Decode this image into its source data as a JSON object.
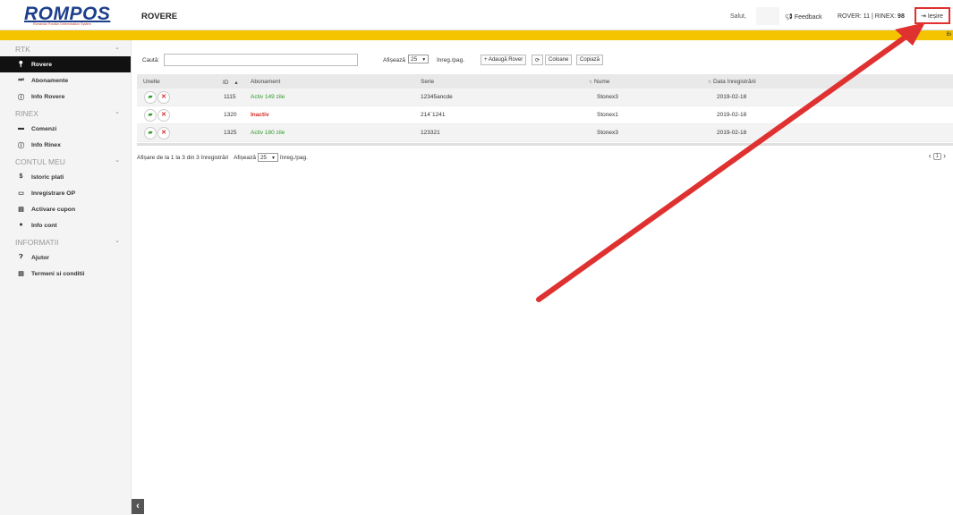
{
  "header": {
    "logo": "ROMPOS",
    "logo_sub": "Romanian Position Determination System",
    "page_title": "ROVERE",
    "greeting": "Salut,",
    "feedback_label": "Feedback",
    "counters_prefix": "ROVER: 11 | RINEX: ",
    "counters_rinex": "98",
    "logout_label": "Ieșire"
  },
  "banner": {
    "text": "Bi"
  },
  "sidebar": {
    "sections": [
      {
        "title": "RTK",
        "items": [
          {
            "label": "Rovere",
            "icon": "pin-icon",
            "active": true
          },
          {
            "label": "Abonamente",
            "icon": "fast-forward-icon"
          },
          {
            "label": "Info Rovere",
            "icon": "info-icon"
          }
        ]
      },
      {
        "title": "RINEX",
        "items": [
          {
            "label": "Comenzi",
            "icon": "folder-icon"
          },
          {
            "label": "Info Rinex",
            "icon": "info-icon"
          }
        ]
      },
      {
        "title": "CONTUL MEU",
        "items": [
          {
            "label": "Istoric plati",
            "icon": "money-icon"
          },
          {
            "label": "Inregistrare OP",
            "icon": "card-icon"
          },
          {
            "label": "Activare cupon",
            "icon": "document-icon"
          },
          {
            "label": "Info cont",
            "icon": "user-icon"
          }
        ]
      },
      {
        "title": "INFORMATII",
        "items": [
          {
            "label": "Ajutor",
            "icon": "help-icon"
          },
          {
            "label": "Termeni si conditii",
            "icon": "file-icon"
          }
        ]
      }
    ]
  },
  "toolbar": {
    "search_label": "Caută:",
    "search_value": "",
    "show_label": "Afișează",
    "page_size": "25",
    "per_page_label": "înreg./pag.",
    "add_rover_label": "+ Adaugă Rover",
    "columns_label": "Coloane",
    "copy_label": "Copiază"
  },
  "table": {
    "headers": [
      "Unelte",
      "ID",
      "Abonament",
      "Serie",
      "Nume",
      "Data înregistrării"
    ],
    "rows": [
      {
        "id": "1115",
        "abonament": "Activ 149 zile",
        "status": "active",
        "serie": "12345ancde",
        "nume": "Stonex3",
        "data": "2019-02-18"
      },
      {
        "id": "1320",
        "abonament": "Inactiv",
        "status": "inactive",
        "serie": "214`1241",
        "nume": "Stonex1",
        "data": "2019-02-18"
      },
      {
        "id": "1325",
        "abonament": "Activ 180 zile",
        "status": "active",
        "serie": "123321",
        "nume": "Stonex3",
        "data": "2019-02-18"
      }
    ]
  },
  "footer": {
    "info": "Afișare de la 1 la 3 din 3 înregistrări",
    "show_label": "Afișează",
    "page_size": "25",
    "per_page_label": "înreg./pag.",
    "current_page": "1"
  },
  "colors": {
    "accent_yellow": "#f5c400",
    "active_green": "#2e9b2e",
    "inactive_red": "#d62828",
    "annotation_red": "#e03131"
  }
}
